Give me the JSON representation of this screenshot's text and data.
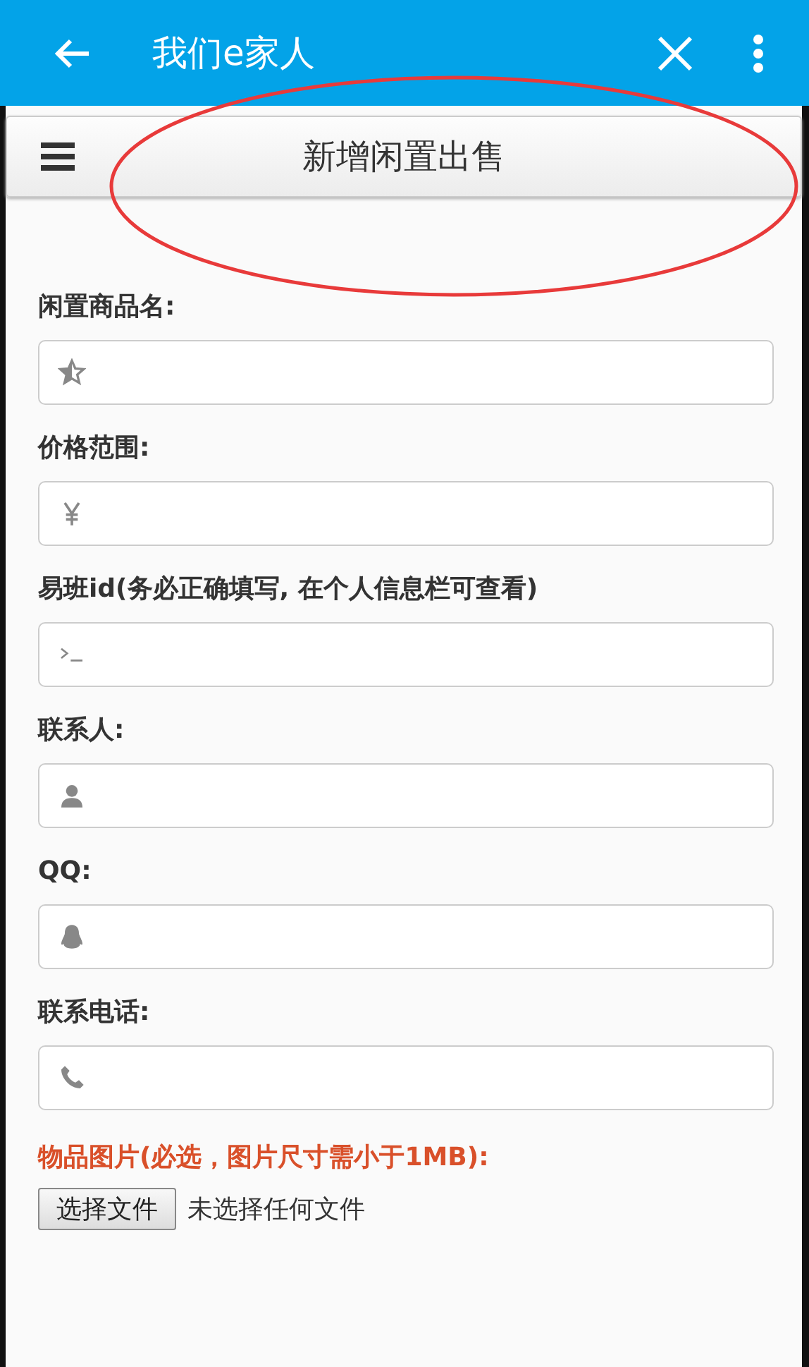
{
  "app_bar": {
    "title": "我们e家人"
  },
  "header": {
    "title": "新增闲置出售"
  },
  "fields": [
    {
      "label": "闲置商品名:",
      "kind": "star"
    },
    {
      "label": "价格范围:",
      "kind": "yen"
    },
    {
      "label": "易班id(务必正确填写, 在个人信息栏可查看)",
      "kind": "terminal"
    },
    {
      "label": "联系人:",
      "kind": "user"
    },
    {
      "label": "QQ:",
      "kind": "penguin"
    },
    {
      "label": "联系电话:",
      "kind": "phone"
    }
  ],
  "upload": {
    "label": "物品图片(必选，图片尺寸需小于1MB):",
    "button": "选择文件",
    "status": "未选择任何文件"
  },
  "annotation": {
    "kind": "ellipse"
  }
}
